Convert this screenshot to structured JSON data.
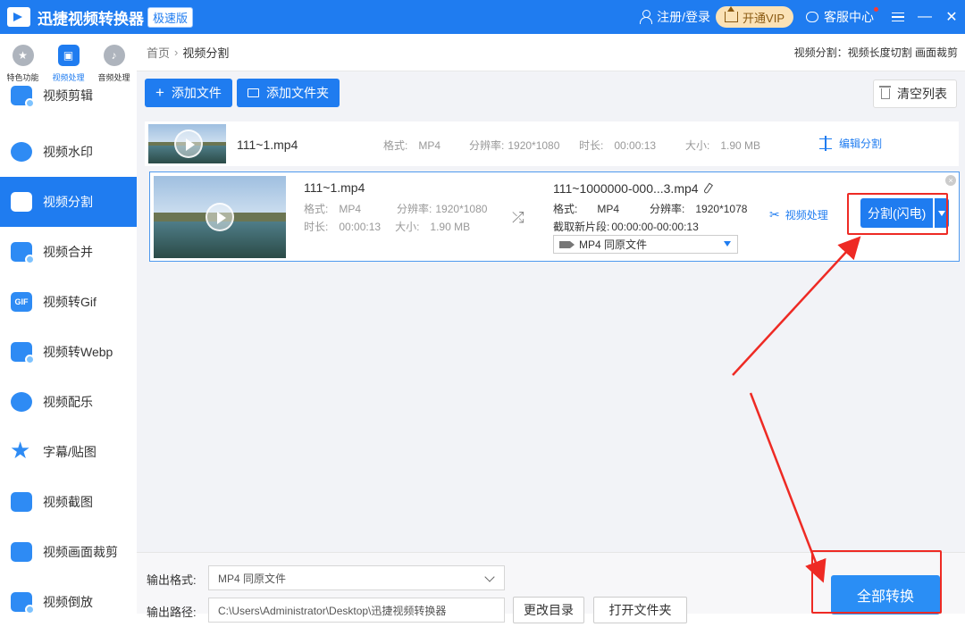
{
  "titlebar": {
    "app_name": "迅捷视频转换器",
    "badge": "极速版",
    "login": "注册/登录",
    "vip": "开通VIP",
    "service": "客服中心",
    "icons": [
      "app-logo-icon",
      "user-icon",
      "crown-icon",
      "chat-icon",
      "menu-icon",
      "minimize-icon",
      "close-icon"
    ]
  },
  "top_tabs": [
    {
      "label": "特色功能",
      "icon": "star-icon"
    },
    {
      "label": "视频处理",
      "icon": "film-icon"
    },
    {
      "label": "音频处理",
      "icon": "music-icon"
    }
  ],
  "sidebar": {
    "items": [
      {
        "label": "视频剪辑"
      },
      {
        "label": "视频水印"
      },
      {
        "label": "视频分割"
      },
      {
        "label": "视频合并"
      },
      {
        "label": "视频转Gif"
      },
      {
        "label": "视频转Webp"
      },
      {
        "label": "视频配乐"
      },
      {
        "label": "字幕/贴图"
      },
      {
        "label": "视频截图"
      },
      {
        "label": "视频画面裁剪"
      },
      {
        "label": "视频倒放"
      }
    ],
    "active": "视频分割"
  },
  "breadcrumb": {
    "home": "首页",
    "separator": "›",
    "current": "视频分割",
    "right_text": "视频分割：视频长度切割 画面裁剪"
  },
  "toolbar": {
    "add_file": "添加文件",
    "add_folder": "添加文件夹",
    "clear_list": "清空列表"
  },
  "file_row": {
    "name": "111~1.mp4",
    "format_label": "格式:",
    "format": "MP4",
    "resolution_label": "分辨率:",
    "resolution": "1920*1080",
    "duration_label": "时长:",
    "duration": "00:00:13",
    "size_label": "大小:",
    "size": "1.90 MB",
    "edit_split": "编辑分割"
  },
  "split_panel": {
    "src_name": "111~1.mp4",
    "src_format_label": "格式:",
    "src_format": "MP4",
    "src_res_label": "分辨率:",
    "src_res": "1920*1080",
    "src_dur_label": "时长:",
    "src_dur": "00:00:13",
    "src_size_label": "大小:",
    "src_size": "1.90 MB",
    "out_name": "111~1000000-000...3.mp4",
    "out_format_label": "格式:",
    "out_format": "MP4",
    "out_res_label": "分辨率:",
    "out_res": "1920*1078",
    "segment_label": "截取新片段:",
    "segment": "00:00:00-00:00:13",
    "format_select": "MP4  同原文件",
    "video_process": "视频处理",
    "split_button": "分割(闪电)"
  },
  "bottom": {
    "output_format_label": "输出格式:",
    "output_format": "MP4  同原文件",
    "output_path_label": "输出路径:",
    "output_path": "C:\\Users\\Administrator\\Desktop\\迅捷视频转换器",
    "change_dir": "更改目录",
    "open_folder": "打开文件夹",
    "convert_all": "全部转换"
  },
  "colors": {
    "accent": "#1f7cf0",
    "annotation": "#ee2a24",
    "vip_bg": "#fbe2b6"
  }
}
